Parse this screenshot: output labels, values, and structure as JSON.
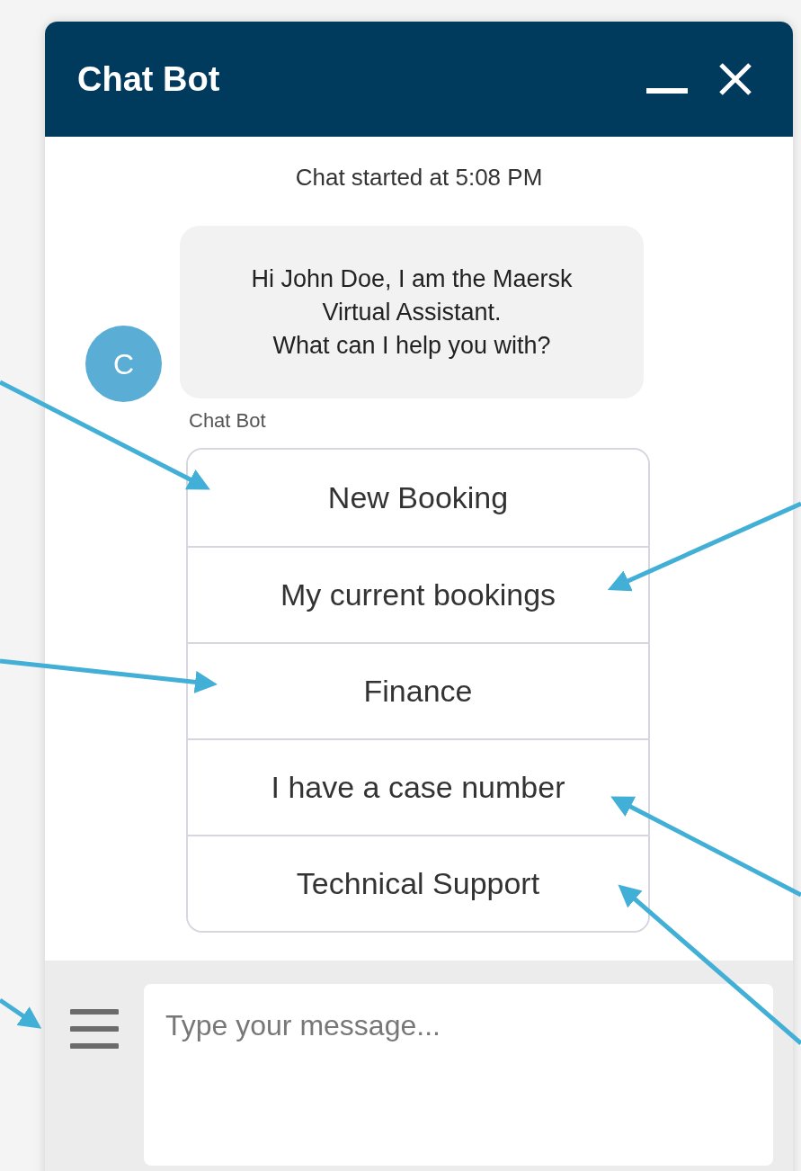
{
  "window": {
    "title": "Chat Bot"
  },
  "chat": {
    "started": "Chat started at 5:08 PM",
    "message": {
      "avatar": "C",
      "text": "Hi John Doe, I am the Maersk\nVirtual Assistant.\nWhat can I help you with?",
      "sender": "Chat Bot"
    },
    "options": [
      "New Booking",
      "My current bookings",
      "Finance",
      "I have a case number",
      "Technical Support"
    ]
  },
  "composer": {
    "placeholder": "Type your message..."
  }
}
